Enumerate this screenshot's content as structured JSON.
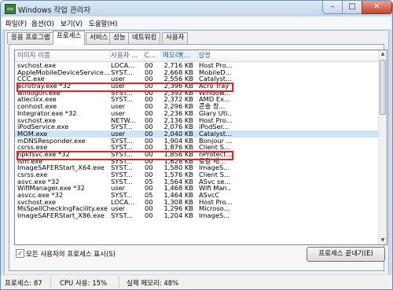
{
  "window": {
    "title": "Windows 작업 관리자",
    "controls": {
      "minimize": "–",
      "maximize": "□",
      "close": "✕"
    }
  },
  "menu": [
    "파일(F)",
    "옵션(O)",
    "보기(V)",
    "도움말(H)"
  ],
  "tabs": [
    "응용 프로그램",
    "프로세스",
    "서비스",
    "성능",
    "네트워킹",
    "사용자"
  ],
  "active_tab": "프로세스",
  "columns": [
    "이미지 이름",
    "사용자 ...",
    "C...",
    "메모리(...",
    "설명"
  ],
  "sorted_column": "메모리(...",
  "processes": [
    {
      "name": "svchost.exe",
      "user": "LOCA...",
      "cpu": "00",
      "mem": "2,716 KB",
      "desc": "Host Pro..."
    },
    {
      "name": "AppleMobileDeviceService...",
      "user": "SYST...",
      "cpu": "00",
      "mem": "2,668 KB",
      "desc": "MobileD..."
    },
    {
      "name": "CCC.exe",
      "user": "user",
      "cpu": "00",
      "mem": "2,556 KB",
      "desc": "Catalyst..."
    },
    {
      "name": "acrotray.exe *32",
      "user": "user",
      "cpu": "00",
      "mem": "2,396 KB",
      "desc": "Acro Tray"
    },
    {
      "name": "winlogon.exe",
      "user": "SYST...",
      "cpu": "00",
      "mem": "2,392 KB",
      "desc": "Window..."
    },
    {
      "name": "atieclxx.exe",
      "user": "SYST...",
      "cpu": "00",
      "mem": "2,372 KB",
      "desc": "AMD Ex..."
    },
    {
      "name": "conhost.exe",
      "user": "user",
      "cpu": "00",
      "mem": "2,296 KB",
      "desc": "콘솔 창..."
    },
    {
      "name": "Integrator.exe *32",
      "user": "user",
      "cpu": "00",
      "mem": "2,236 KB",
      "desc": "Glary Uti..."
    },
    {
      "name": "svchost.exe",
      "user": "NETW...",
      "cpu": "00",
      "mem": "2,136 KB",
      "desc": "Host Pro..."
    },
    {
      "name": "iPodService.exe",
      "user": "SYST...",
      "cpu": "00",
      "mem": "2,076 KB",
      "desc": "iPodSer..."
    },
    {
      "name": "MOM.exe",
      "user": "user",
      "cpu": "00",
      "mem": "2,040 KB",
      "desc": "Catalyst..."
    },
    {
      "name": "mDNSResponder.exe",
      "user": "SYST...",
      "cpu": "00",
      "mem": "1,904 KB",
      "desc": "Bonjour ..."
    },
    {
      "name": "csrss.exe",
      "user": "SYST...",
      "cpu": "00",
      "mem": "1,876 KB",
      "desc": "Client S..."
    },
    {
      "name": "npkfsvc.exe *32",
      "user": "SYST...",
      "cpu": "00",
      "mem": "1,856 KB",
      "desc": "nProtect..."
    },
    {
      "name": "lsm.exe",
      "user": "SYST...",
      "cpu": "00",
      "mem": "1,628 KB",
      "desc": "로컬 세..."
    },
    {
      "name": "ImageSAFERStart_X64.exe",
      "user": "SYST...",
      "cpu": "00",
      "mem": "1,580 KB",
      "desc": "ImageS..."
    },
    {
      "name": "csrss.exe",
      "user": "SYST...",
      "cpu": "00",
      "mem": "1,576 KB",
      "desc": "Client S..."
    },
    {
      "name": "asvc.exe *32",
      "user": "SYST...",
      "cpu": "05",
      "mem": "1,564 KB",
      "desc": "ASvc se..."
    },
    {
      "name": "WifiManager.exe *32",
      "user": "user",
      "cpu": "00",
      "mem": "1,468 KB",
      "desc": "Wifi Man..."
    },
    {
      "name": "asvcc.exe *32",
      "user": "SYST...",
      "cpu": "05",
      "mem": "1,464 KB",
      "desc": "ASvcC"
    },
    {
      "name": "svchost.exe",
      "user": "LOCA...",
      "cpu": "00",
      "mem": "1,308 KB",
      "desc": "Host Pro..."
    },
    {
      "name": "MsSpellCheckingFacility.exe",
      "user": "user",
      "cpu": "00",
      "mem": "1,296 KB",
      "desc": "Microso..."
    },
    {
      "name": "ImageSAFERStart_X86.exe",
      "user": "SYST...",
      "cpu": "00",
      "mem": "1,204 KB",
      "desc": "ImageS..."
    }
  ],
  "show_all_label": "모든 사용자의 프로세스 표시(S)",
  "show_all_checked": "✓",
  "end_process_label": "프로세스 끝내기(E)",
  "status": {
    "processes": "프로세스: 87",
    "cpu": "CPU 사용: 15%",
    "memory": "실제 메모리: 48%"
  }
}
